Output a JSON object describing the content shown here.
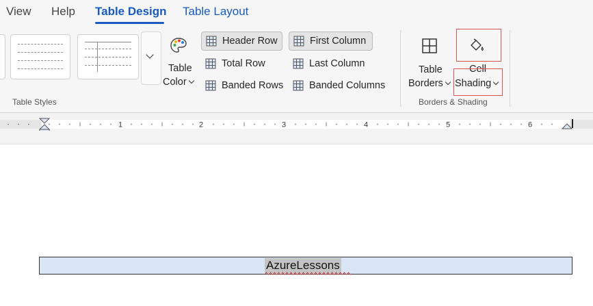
{
  "tabs": {
    "view": "View",
    "help": "Help",
    "table_design": "Table Design",
    "table_layout": "Table Layout"
  },
  "ribbon": {
    "table_styles": {
      "group_label": "Table Styles"
    },
    "table_color": {
      "line1": "Table",
      "line2": "Color"
    },
    "style_options": {
      "header_row": "Header Row",
      "first_column": "First Column",
      "total_row": "Total Row",
      "last_column": "Last Column",
      "banded_rows": "Banded Rows",
      "banded_columns": "Banded Columns",
      "checked": [
        "header_row",
        "first_column"
      ]
    },
    "borders_shading": {
      "group_label": "Borders & Shading",
      "table_borders_line1": "Table",
      "table_borders_line2": "Borders",
      "cell_shading_line1": "Cell",
      "cell_shading_line2": "Shading"
    }
  },
  "ruler": {
    "numbers": [
      "1",
      "2",
      "3",
      "4",
      "5",
      "6"
    ]
  },
  "document": {
    "cell_text": "AzureLessons"
  },
  "colors": {
    "accent": "#185abd",
    "highlight_box": "#d9534f",
    "table_fill": "#dae6f5",
    "text_selection": "#c4c4c4"
  }
}
